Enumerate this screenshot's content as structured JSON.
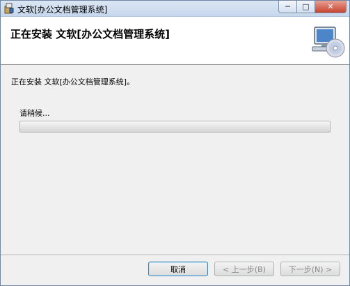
{
  "window": {
    "title": "文软[办公文档管理系统]",
    "minimize_glyph": "─",
    "maximize_glyph": "□",
    "close_glyph": "✕"
  },
  "header": {
    "title": "正在安装 文软[办公文档管理系统]",
    "icon": "cd-install-icon"
  },
  "body": {
    "status": "正在安装 文软[办公文档管理系统]。",
    "wait_label": "请稍候...",
    "progress": 0
  },
  "footer": {
    "cancel_label": "取消",
    "back_label": "< 上一步(B)",
    "next_label": "下一步(N) >"
  },
  "colors": {
    "titlebar": "#c7d7ec",
    "close_button": "#c7432f",
    "header_bg": "#ffffff",
    "window_bg": "#f0f0f0"
  }
}
